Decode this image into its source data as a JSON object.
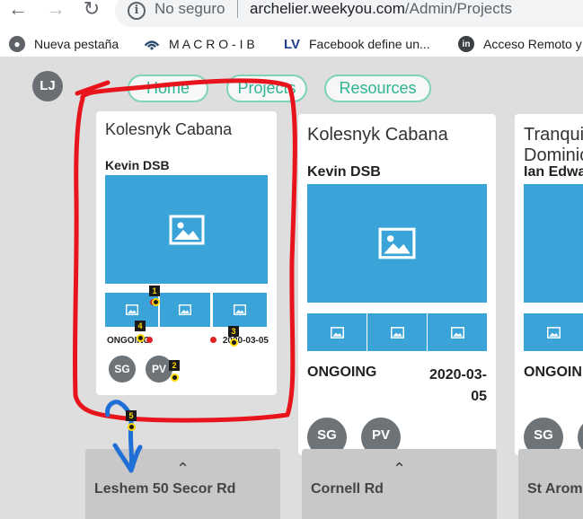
{
  "browser": {
    "not_secure": "No seguro",
    "url_domain": "archelier.weekyou.com",
    "url_path": "/Admin/Projects",
    "bookmarks": [
      {
        "label": "Nueva pestaña",
        "icon": "globe-icon"
      },
      {
        "label": "M A C R O - I B",
        "icon": "wifi-icon"
      },
      {
        "label": "Facebook define un...",
        "icon": "lv-logo-icon",
        "icon_text": "LV"
      },
      {
        "label": "Acceso Remoto y",
        "icon": "linkedin-icon",
        "icon_text": "in"
      }
    ]
  },
  "app": {
    "user_initials": "LJ",
    "nav": [
      "Home",
      "Projects",
      "Resources"
    ],
    "projects": [
      {
        "title": "Kolesnyk Cabana",
        "client": "Kevin DSB",
        "status": "ONGOING",
        "date": "2020-03-05",
        "members": [
          "SG",
          "PV"
        ]
      },
      {
        "title": "Kolesnyk Cabana",
        "client": "Kevin DSB",
        "status": "ONGOING",
        "date_line1": "2020-03-",
        "date_line2": "05",
        "members": [
          "SG",
          "PV"
        ]
      },
      {
        "title_line1": "Tranqui",
        "title_line2": "Dominic",
        "client": "Ian Edwa",
        "status": "ONGOIN",
        "members": [
          "SG",
          "P"
        ]
      }
    ],
    "locations": [
      "Leshem 50 Secor Rd",
      "Cornell Rd",
      "St Arom"
    ]
  },
  "annotations": {
    "markers": [
      "1",
      "2",
      "3",
      "4",
      "5"
    ],
    "colors": {
      "highlight": "#e8141c",
      "arrow": "#1e6fd6",
      "marker_text": "#ffd800",
      "marker_bg": "#1a1a1a"
    }
  },
  "colors": {
    "accent": "#2fb492",
    "pill_border": "#7fd3b8",
    "image": "#3aa4d8",
    "chip": "#6e7378"
  }
}
